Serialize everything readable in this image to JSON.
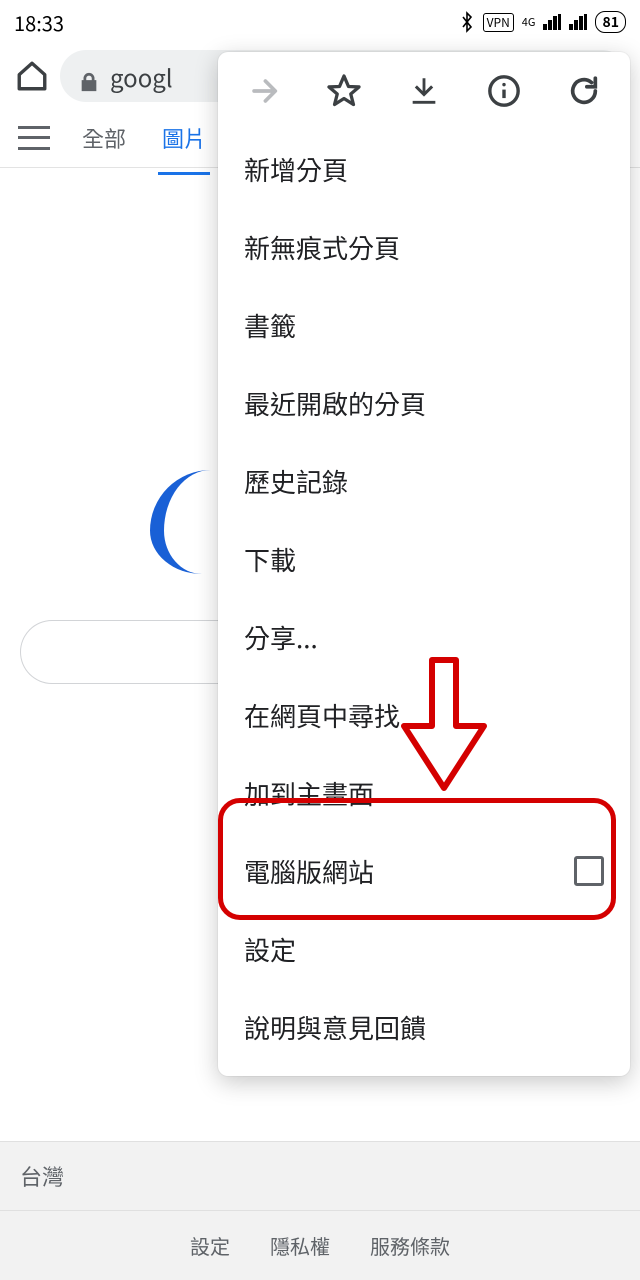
{
  "status": {
    "time": "18:33",
    "vpn": "VPN",
    "network": "4G",
    "battery": "81"
  },
  "urlbar": {
    "text": "googl"
  },
  "tabs": {
    "all": "全部",
    "images": "圖片"
  },
  "menu": {
    "new_tab": "新增分頁",
    "new_incognito": "新無痕式分頁",
    "bookmarks": "書籤",
    "recent": "最近開啟的分頁",
    "history": "歷史記錄",
    "downloads": "下載",
    "share": "分享...",
    "find": "在網頁中尋找",
    "add_home": "加到主畫面",
    "desktop": "電腦版網站",
    "settings": "設定",
    "help": "說明與意見回饋"
  },
  "footer": {
    "region": "台灣",
    "settings": "設定",
    "privacy": "隱私權",
    "terms": "服務條款"
  }
}
